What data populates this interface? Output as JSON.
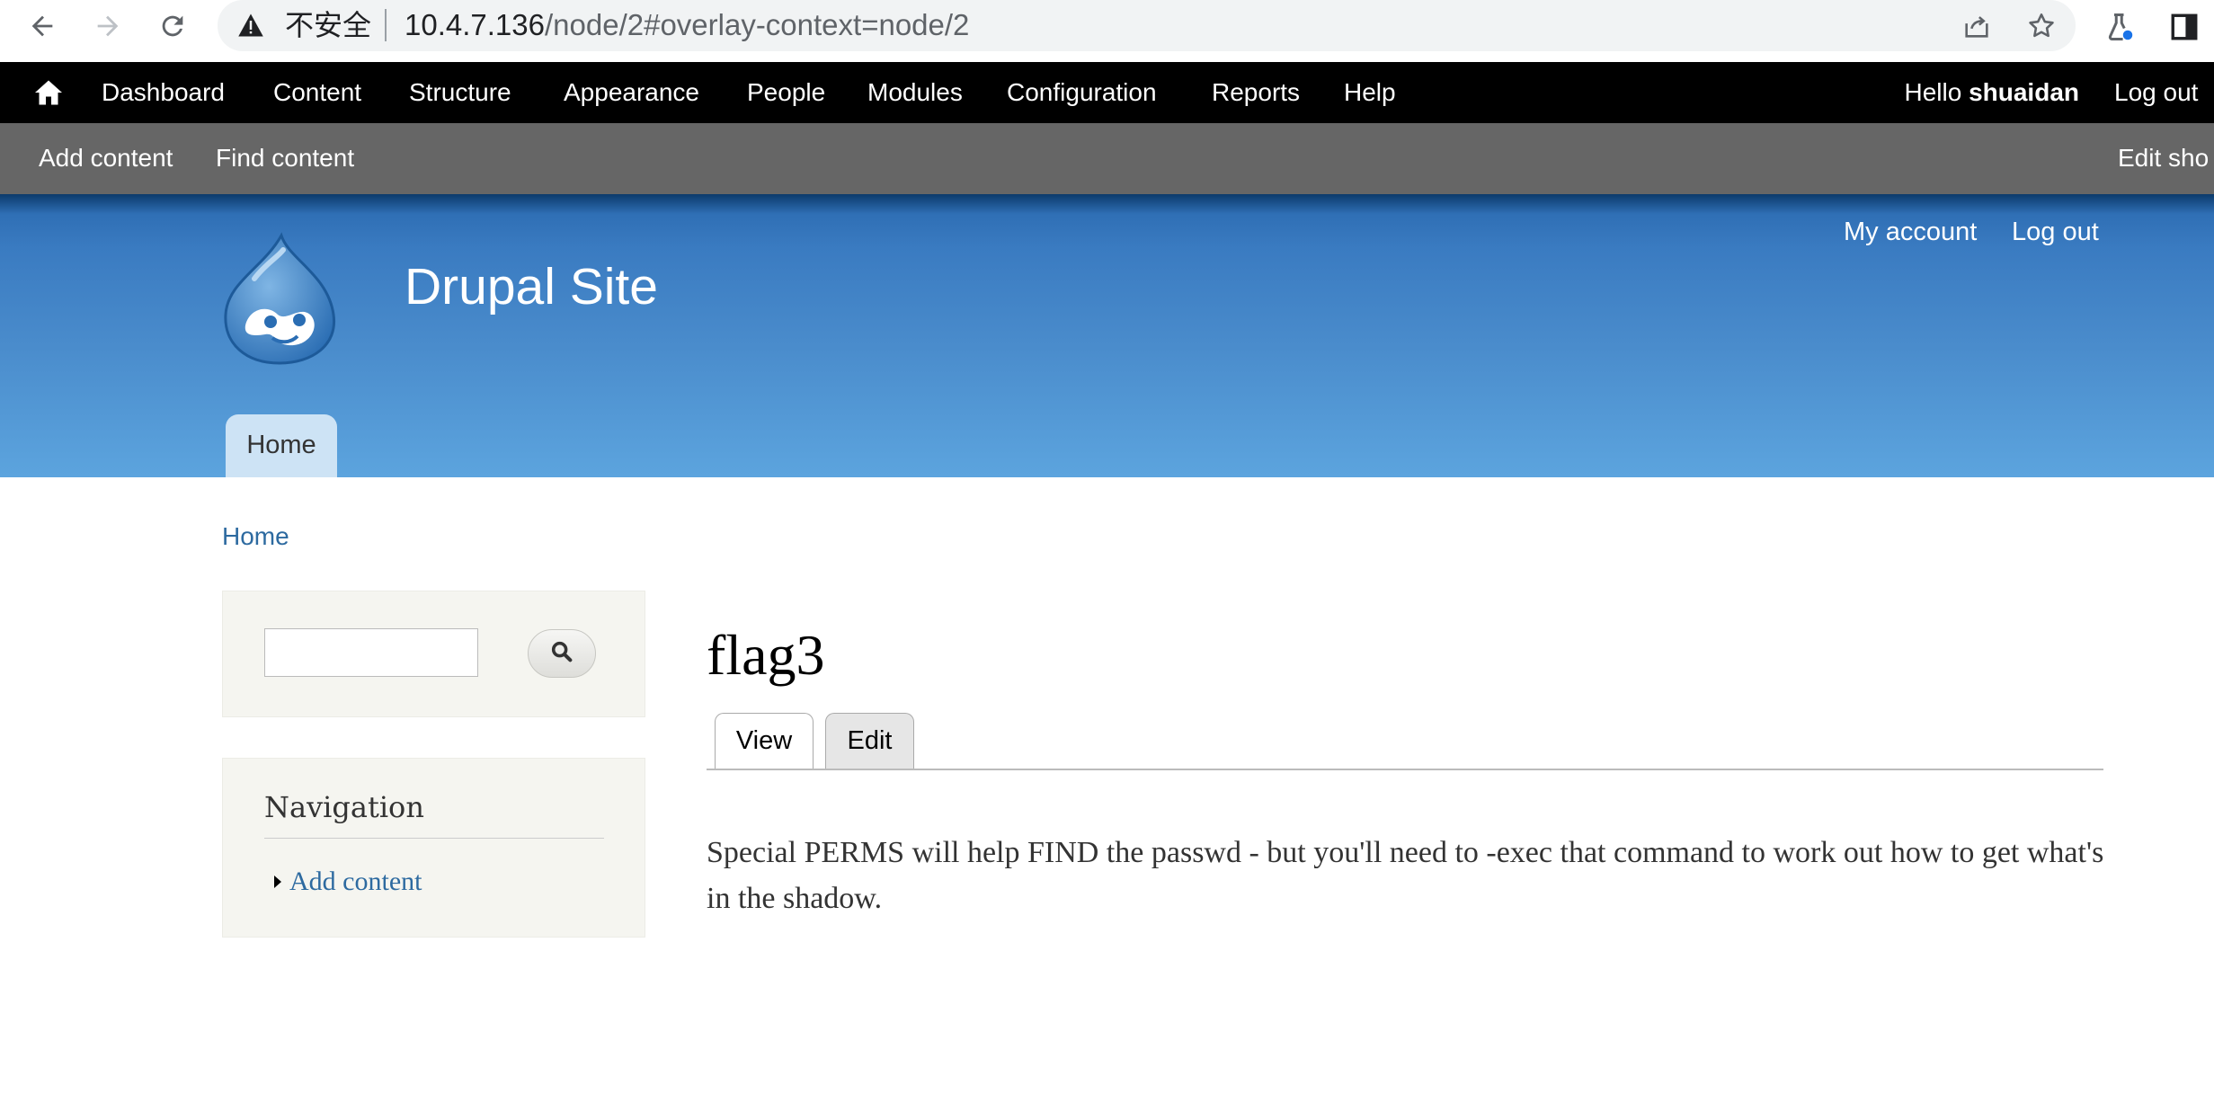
{
  "browser": {
    "security_label": "不安全",
    "url_host": "10.4.7.136",
    "url_path": "/node/2#overlay-context=node/2",
    "icons": [
      "back-arrow-icon",
      "forward-arrow-icon",
      "reload-icon",
      "warning-icon",
      "share-icon",
      "star-icon",
      "labs-flask-icon",
      "side-panel-icon"
    ]
  },
  "toolbar": {
    "items": [
      "Dashboard",
      "Content",
      "Structure",
      "Appearance",
      "People",
      "Modules",
      "Configuration",
      "Reports",
      "Help"
    ],
    "hello_prefix": "Hello ",
    "username": "shuaidan",
    "logout": "Log out"
  },
  "shortcuts": {
    "items": [
      "Add content",
      "Find content"
    ],
    "edit_shortcuts": "Edit sho"
  },
  "header": {
    "site_name": "Drupal Site",
    "secondary_menu": [
      "My account",
      "Log out"
    ],
    "primary_tab": "Home",
    "colors": {
      "gradient_top": "#0b3a6b",
      "gradient_bottom": "#5ca4de",
      "tab_bg": "#cde3f5"
    }
  },
  "breadcrumb": "Home",
  "sidebar": {
    "navigation_title": "Navigation",
    "navigation_link": "Add content"
  },
  "node": {
    "title": "flag3",
    "tabs": [
      "View",
      "Edit"
    ],
    "body": "Special PERMS will help FIND the passwd - but you'll need to -exec that command to work out how to get what's in the shadow."
  },
  "colors": {
    "link": "#2d6aa0",
    "toolbar": "#000000",
    "shortcuts": "#666666"
  }
}
